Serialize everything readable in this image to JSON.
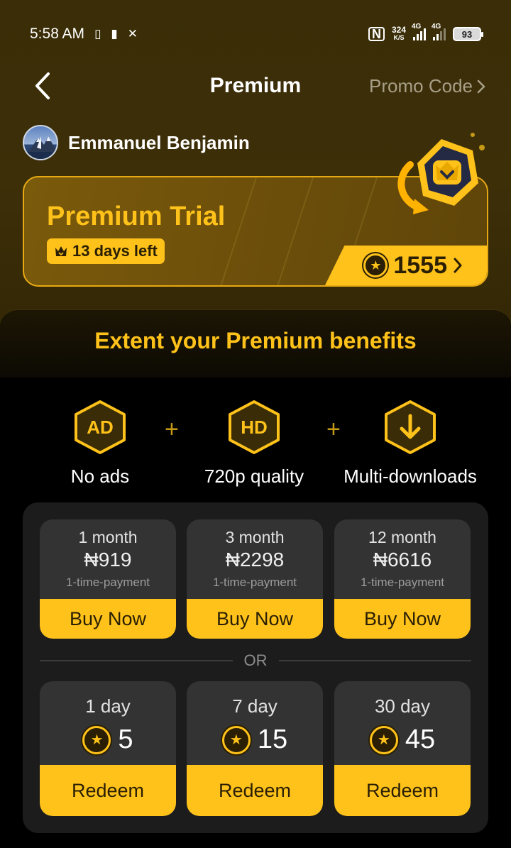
{
  "status_bar": {
    "time": "5:58 AM",
    "net_speed": "324",
    "net_speed_unit": "K/S",
    "signal1_label": "4G",
    "signal2_label": "4G",
    "battery": "93"
  },
  "header": {
    "title": "Premium",
    "promo_label": "Promo Code"
  },
  "user": {
    "name": "Emmanuel Benjamin"
  },
  "trial": {
    "title": "Premium Trial",
    "days_left": "13 days left",
    "coin_balance": "1555"
  },
  "benefits": {
    "title": "Extent your Premium benefits",
    "items": [
      {
        "icon": "AD",
        "label": "No ads"
      },
      {
        "icon": "HD",
        "label": "720p quality"
      },
      {
        "icon": "download-icon",
        "label": "Multi-downloads"
      }
    ]
  },
  "plans": [
    {
      "name": "1 month",
      "price": "₦919",
      "note": "1-time-payment",
      "button": "Buy Now"
    },
    {
      "name": "3 month",
      "price": "₦2298",
      "note": "1-time-payment",
      "button": "Buy Now"
    },
    {
      "name": "12 month",
      "price": "₦6616",
      "note": "1-time-payment",
      "button": "Buy Now"
    }
  ],
  "or_label": "OR",
  "redeem_options": [
    {
      "name": "1 day",
      "cost": "5",
      "button": "Redeem"
    },
    {
      "name": "7 day",
      "cost": "15",
      "button": "Redeem"
    },
    {
      "name": "30 day",
      "cost": "45",
      "button": "Redeem"
    }
  ],
  "colors": {
    "accent": "#ffc21a",
    "header_bg": "#3d2f08",
    "card_bg": "#333333",
    "panel_bg": "#1c1c1c"
  }
}
